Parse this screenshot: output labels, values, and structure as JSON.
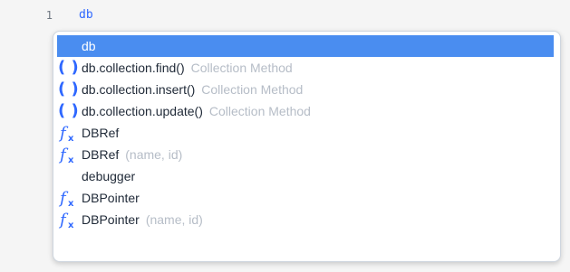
{
  "editor": {
    "line_number": "1",
    "line_text": "db"
  },
  "completion_popup": {
    "items": [
      {
        "typed": "db",
        "rest": "",
        "detail": "",
        "icon": "none",
        "selected": true
      },
      {
        "typed": "db",
        "rest": ".collection.find()",
        "detail": "Collection Method",
        "icon": "method-parens-icon",
        "selected": false
      },
      {
        "typed": "db",
        "rest": ".collection.insert()",
        "detail": "Collection Method",
        "icon": "method-parens-icon",
        "selected": false
      },
      {
        "typed": "db",
        "rest": ".collection.update()",
        "detail": "Collection Method",
        "icon": "method-parens-icon",
        "selected": false
      },
      {
        "typed": "DB",
        "rest": "Ref",
        "detail": "",
        "icon": "function-fx-icon",
        "selected": false
      },
      {
        "typed": "DB",
        "rest": "Ref",
        "detail": "(name, id)",
        "icon": "function-fx-icon",
        "selected": false
      },
      {
        "typed": "de",
        "rest": "bugger",
        "detail": "",
        "icon": "none",
        "selected": false
      },
      {
        "typed": "DB",
        "rest": "Pointer",
        "detail": "",
        "icon": "function-fx-icon",
        "selected": false
      },
      {
        "typed": "DB",
        "rest": "Pointer",
        "detail": "(name, id)",
        "icon": "function-fx-icon",
        "selected": false
      }
    ]
  },
  "colors": {
    "selection": "#4a8df0",
    "icon": "#2f68ff",
    "detail": "#b6bdc7",
    "code": "#2f68ff"
  }
}
